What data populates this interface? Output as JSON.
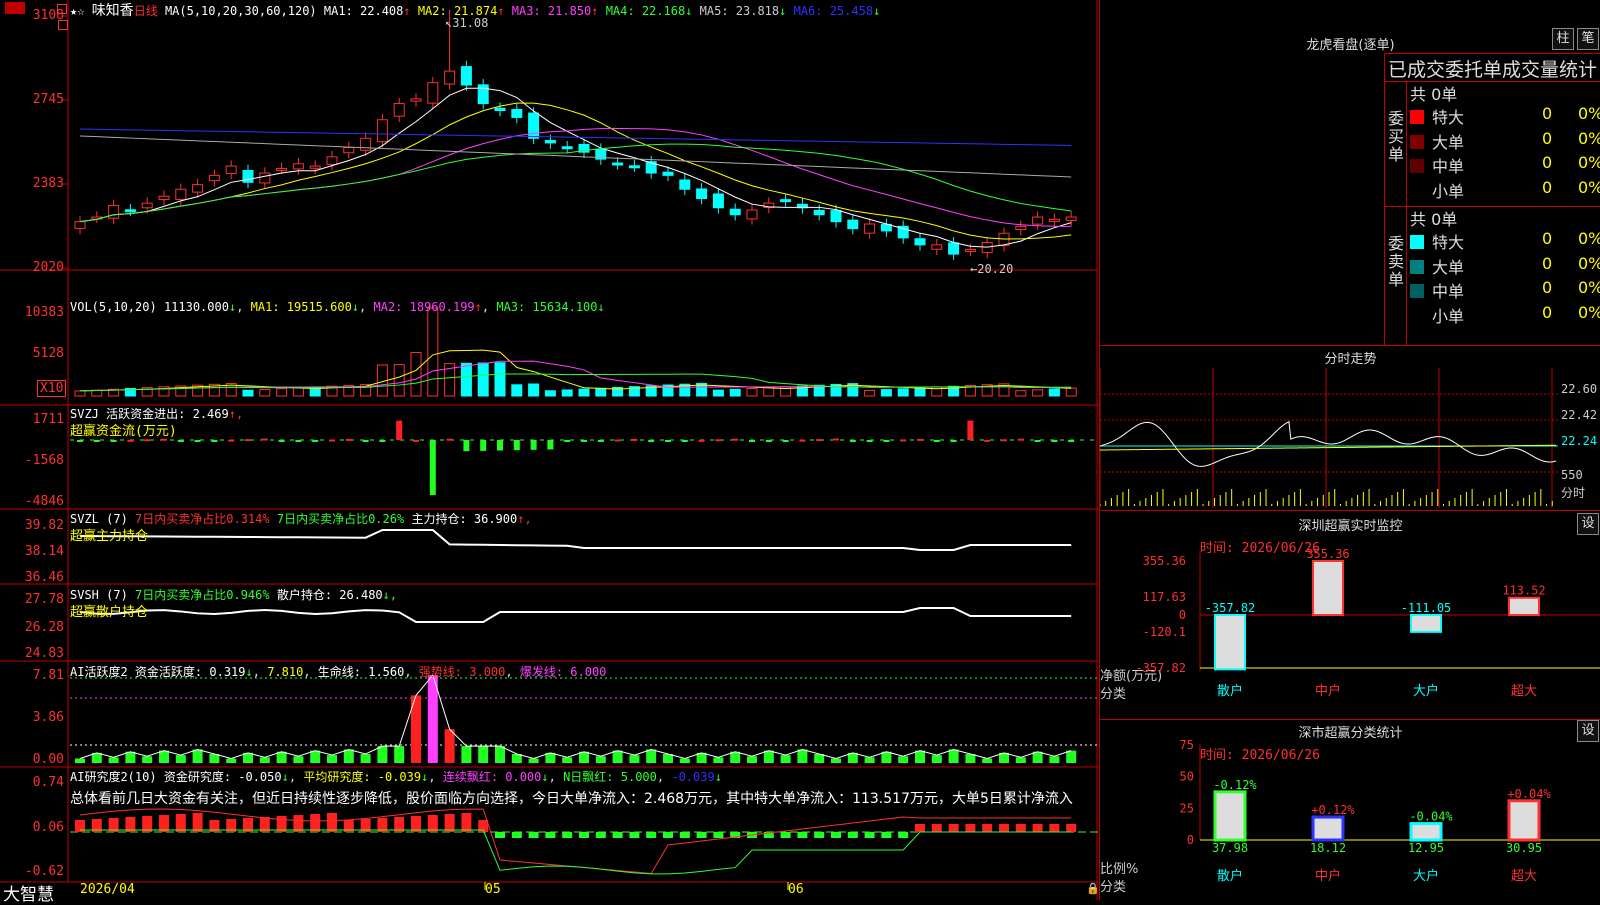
{
  "app": {
    "logo": "大智慧",
    "stars": "★☆"
  },
  "stock": {
    "name": "味知香",
    "period": "日线"
  },
  "ma_legend": {
    "params": "MA(5,10,20,30,60,120)",
    "items": [
      {
        "label": "MA1: 22.408",
        "arrow": "↑",
        "color": "#ffffff"
      },
      {
        "label": "MA2: 21.874",
        "arrow": "↑",
        "color": "#ffff00"
      },
      {
        "label": "MA3: 21.850",
        "arrow": "↑",
        "color": "#ff40ff"
      },
      {
        "label": "MA4: 22.168",
        "arrow": "↓",
        "color": "#30ff30"
      },
      {
        "label": "MA5: 23.818",
        "arrow": "↓",
        "color": "#cccccc"
      },
      {
        "label": "MA6: 25.458",
        "arrow": "↓",
        "color": "#3030ff"
      }
    ]
  },
  "price_axis": [
    "3108",
    "2745",
    "2383",
    "2020"
  ],
  "price_annotations": {
    "high": "31.08",
    "low": "←20.20"
  },
  "vol": {
    "title": "VOL(5,10,20)",
    "value": "11130.000",
    "v_arrow": "↓",
    "ma1": "MA1: 19515.600",
    "ma1_arrow": "↓",
    "ma2": "MA2: 18960.199",
    "ma2_arrow": "↑",
    "ma3": "MA3: 15634.100",
    "ma3_arrow": "↓",
    "axis": [
      "10383",
      "5128"
    ],
    "unit": "X10"
  },
  "svzj": {
    "title": "SVZJ",
    "desc": "活跃资金进出: 2.469",
    "arrow": "↑,",
    "sub": "超赢资金流(万元)",
    "axis": [
      "1711",
      "-1568",
      "-4846"
    ]
  },
  "svzl": {
    "title": "SVZL (7)",
    "a": "7日内买卖净占比0.314%",
    "b": "7日内买卖净占比0.26%",
    "c": "主力持仓: 36.900",
    "arrow": "↑,",
    "sub": "超赢主力持仓",
    "axis": [
      "39.82",
      "38.14",
      "36.46"
    ]
  },
  "svsh": {
    "title": "SVSH (7)",
    "a": "7日内买卖净占比0.946%",
    "c": "散户持仓: 26.480",
    "arrow": "↓,",
    "sub": "超赢散户持仓",
    "axis": [
      "27.78",
      "26.28",
      "24.83"
    ]
  },
  "ai1": {
    "title": "AI活跃度2",
    "a": "资金活跃度: 0.319",
    "a_arrow": "↓",
    "b": "7.810",
    "c": "生命线: 1.560",
    "d": "强势线: 3.000",
    "e": "爆发线: 6.000",
    "axis": [
      "7.81",
      "3.86",
      "0.00"
    ]
  },
  "ai2": {
    "title": "AI研究度2(10)",
    "a": "资金研究度: -0.050",
    "a_arrow": "↓",
    "b": "平均研究度: -0.039",
    "b_arrow": "↓",
    "c": "连续飘红: 0.000",
    "c_arrow": "↓",
    "d": "N日飘红: 5.000",
    "e": "-0.039",
    "e_arrow": "↓",
    "axis": [
      "0.74",
      "0.06",
      "-0.62"
    ],
    "summary": "总体看前几日大资金有关注，但近日持续性逐步降低，股价面临方向选择，今日大单净流入：2.468万元，其中特大单净流入：113.517万元，大单5日累计净流入"
  },
  "xaxis": [
    "2026/04",
    "05",
    "06"
  ],
  "dragon": {
    "title": "龙虎看盘(逐单)",
    "btn1": "柱",
    "btn2": "笔",
    "header": "已成交委托单成交量统计",
    "buy": {
      "side": "委买单",
      "total": "共 0单",
      "rows": [
        {
          "label": "特大",
          "n": "0",
          "p": "0%",
          "color": "#ff0000"
        },
        {
          "label": "大单",
          "n": "0",
          "p": "0%",
          "color": "#800000"
        },
        {
          "label": "中单",
          "n": "0",
          "p": "0%",
          "color": "#600000"
        },
        {
          "label": "小单",
          "n": "0",
          "p": "0%",
          "color": "#000000"
        }
      ]
    },
    "sell": {
      "side": "委卖单",
      "total": "共 0单",
      "rows": [
        {
          "label": "特大",
          "n": "0",
          "p": "0%",
          "color": "#00ffff"
        },
        {
          "label": "大单",
          "n": "0",
          "p": "0%",
          "color": "#008080"
        },
        {
          "label": "中单",
          "n": "0",
          "p": "0%",
          "color": "#006060"
        },
        {
          "label": "小单",
          "n": "0",
          "p": "0%",
          "color": "#000000"
        }
      ]
    }
  },
  "minute": {
    "title": "分时走势",
    "axis": [
      "22.60",
      "22.42",
      "22.24"
    ],
    "vol_axis": "550",
    "vol_label": "分时"
  },
  "monitor": {
    "title": "深圳超赢实时监控",
    "set": "设",
    "time": "时间: 2026/06/26",
    "axis": [
      "355.36",
      "117.63",
      "0",
      "-120.1",
      "-357.82"
    ],
    "ylabel": "净额(万元)",
    "xlabel": "分类",
    "bars": [
      {
        "cat": "散户",
        "value": -357.82,
        "label": "-357.82"
      },
      {
        "cat": "中户",
        "value": 355.36,
        "label": "355.36"
      },
      {
        "cat": "大户",
        "value": -111.05,
        "label": "-111.05"
      },
      {
        "cat": "超大",
        "value": 113.52,
        "label": "113.52"
      }
    ]
  },
  "classify": {
    "title": "深市超赢分类统计",
    "set": "设",
    "time": "时间: 2026/06/26",
    "axis": [
      "75",
      "50",
      "25",
      "0"
    ],
    "ylabel": "比例%",
    "xlabel": "分类",
    "bars": [
      {
        "cat": "散户",
        "value": 37.98,
        "delta": "-0.12%",
        "color": "#30ff30"
      },
      {
        "cat": "中户",
        "value": 18.12,
        "delta": "+0.12%",
        "color": "#3030ff"
      },
      {
        "cat": "大户",
        "value": 12.95,
        "delta": "-0.04%",
        "color": "#00ffff"
      },
      {
        "cat": "超大",
        "value": 30.95,
        "delta": "+0.04%",
        "color": "#ff3030"
      }
    ]
  }
}
